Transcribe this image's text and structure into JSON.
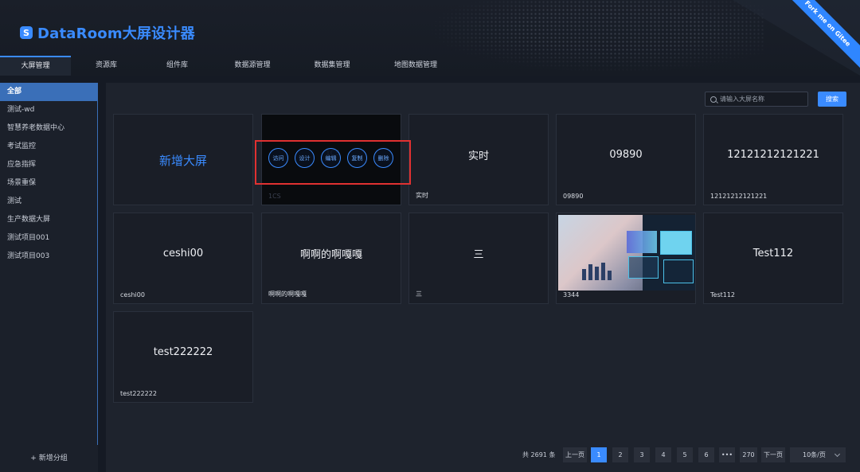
{
  "app": {
    "title": "DataRoom大屏设计器",
    "logo_glyph": "S",
    "ribbon": "Fork me on Gitee",
    "accent": "#3a8bff"
  },
  "nav": {
    "items": [
      {
        "label": "大屏管理"
      },
      {
        "label": "资源库"
      },
      {
        "label": "组件库"
      },
      {
        "label": "数据源管理"
      },
      {
        "label": "数据集管理"
      },
      {
        "label": "地图数据管理"
      }
    ]
  },
  "sidebar": {
    "items": [
      {
        "label": "全部"
      },
      {
        "label": "测试-wd"
      },
      {
        "label": "智慧养老数据中心"
      },
      {
        "label": "考试监控"
      },
      {
        "label": "应急指挥"
      },
      {
        "label": "场景重保"
      },
      {
        "label": "测试"
      },
      {
        "label": "生产数据大屏"
      },
      {
        "label": "测试项目001"
      },
      {
        "label": "测试项目003"
      }
    ],
    "add_label": "+ 新增分组"
  },
  "search": {
    "placeholder": "请输入大屏名称",
    "button": "搜索"
  },
  "cards": {
    "add_label": "新增大屏",
    "hover": {
      "name": "1CS",
      "actions": [
        "访问",
        "设计",
        "编辑",
        "复制",
        "删除"
      ]
    },
    "items": [
      {
        "title": "实时",
        "name": "实时"
      },
      {
        "title": "09890",
        "name": "09890"
      },
      {
        "title": "12121212121221",
        "name": "12121212121221"
      },
      {
        "title": "ceshi00",
        "name": "ceshi00"
      },
      {
        "title": "啊啊的啊嘎嘎",
        "name": "啊啊的啊嘎嘎"
      },
      {
        "title": "三",
        "name": "三"
      },
      {
        "title": "",
        "name": "3344"
      },
      {
        "title": "Test112",
        "name": "Test112"
      },
      {
        "title": "test222222",
        "name": "test222222"
      }
    ]
  },
  "pagination": {
    "total_text": "共 2691 条",
    "prev": "上一页",
    "pages": [
      "1",
      "2",
      "3",
      "4",
      "5",
      "6",
      "•••",
      "270"
    ],
    "current": "1",
    "next": "下一页",
    "page_size": "10条/页"
  }
}
